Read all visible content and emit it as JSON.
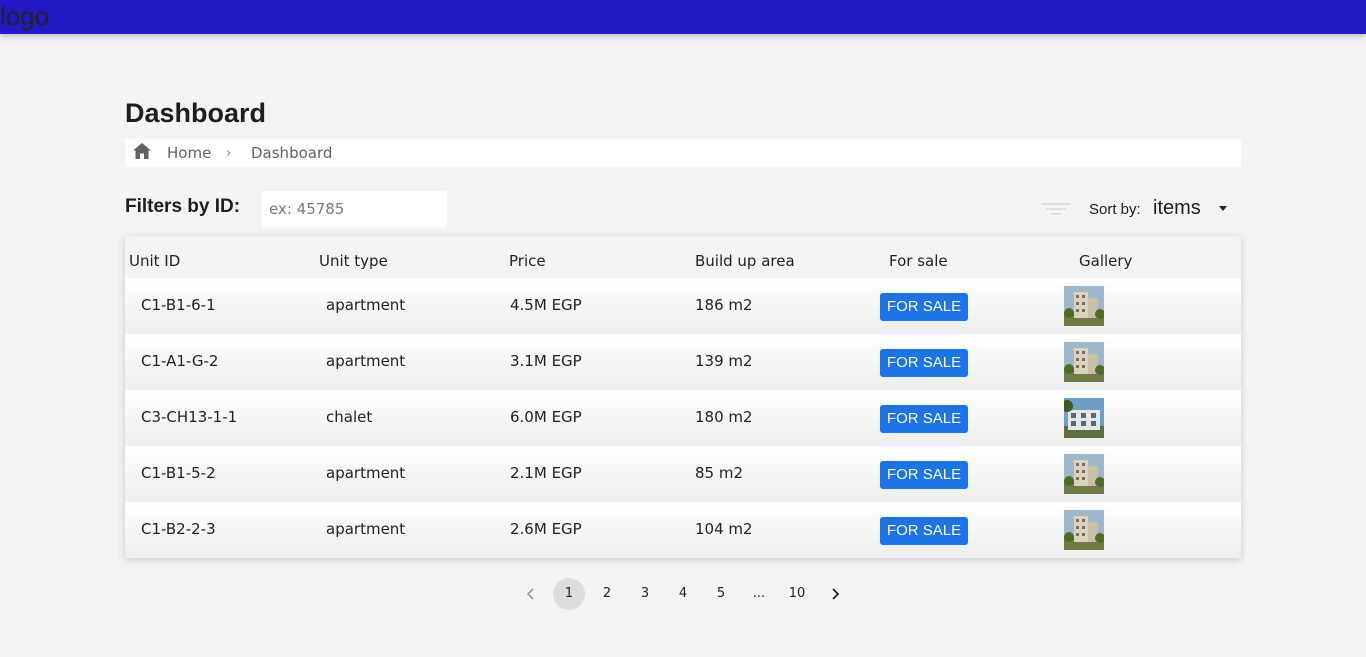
{
  "header": {
    "logo_text": "logo",
    "bar_color": "#2219c4"
  },
  "page": {
    "title": "Dashboard"
  },
  "breadcrumb": {
    "home_label": "Home",
    "separator": "›",
    "current_label": "Dashboard"
  },
  "filter": {
    "label": "Filters by ID:",
    "placeholder": "ex: 45785",
    "value": ""
  },
  "sort": {
    "label": "Sort by:",
    "value": "items"
  },
  "table": {
    "columns": [
      "Unit ID",
      "Unit type",
      "Price",
      "Build up area",
      "For sale",
      "Gallery"
    ],
    "rows": [
      {
        "unit_id": "C1-B1-6-1",
        "unit_type": "apartment",
        "price": "4.5M EGP",
        "area": "186 m2",
        "status": "FOR SALE",
        "gallery_icon": "building-photo-icon"
      },
      {
        "unit_id": "C1-A1-G-2",
        "unit_type": "apartment",
        "price": "3.1M EGP",
        "area": "139 m2",
        "status": "FOR SALE",
        "gallery_icon": "building-photo-icon"
      },
      {
        "unit_id": "C3-CH13-1-1",
        "unit_type": "chalet",
        "price": "6.0M EGP",
        "area": "180 m2",
        "status": "FOR SALE",
        "gallery_icon": "chalet-photo-icon"
      },
      {
        "unit_id": "C1-B1-5-2",
        "unit_type": "apartment",
        "price": "2.1M EGP",
        "area": "85 m2",
        "status": "FOR SALE",
        "gallery_icon": "building-photo-icon"
      },
      {
        "unit_id": "C1-B2-2-3",
        "unit_type": "apartment",
        "price": "2.6M EGP",
        "area": "104 m2",
        "status": "FOR SALE",
        "gallery_icon": "building-photo-icon"
      }
    ]
  },
  "pagination": {
    "pages": [
      "1",
      "2",
      "3",
      "4",
      "5",
      "...",
      "10"
    ],
    "current": "1"
  },
  "colors": {
    "accent": "#1a73e8",
    "background": "#f4f4f4"
  }
}
